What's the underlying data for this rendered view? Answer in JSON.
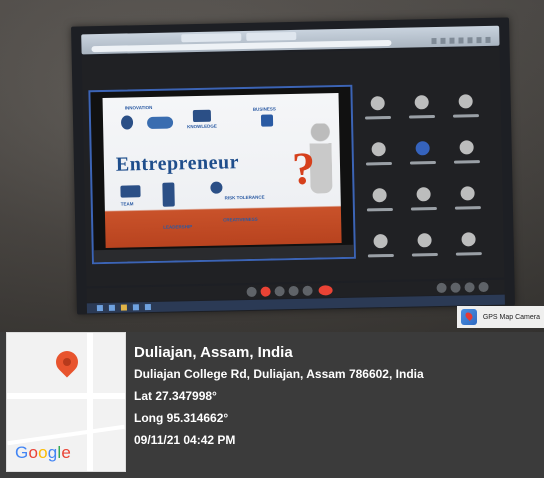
{
  "slide": {
    "title": "Entrepreneur",
    "words": [
      "INNOVATION",
      "BUSINESS",
      "KNOWLEDGE",
      "TEAM",
      "LEADERSHIP",
      "RISK TOLERANCE",
      "CREATIVENESS"
    ]
  },
  "gps_badge": "GPS Map Camera",
  "location": {
    "city": "Duliajan, Assam, India",
    "address": "Duliajan College Rd, Duliajan, Assam 786602, India",
    "lat": "Lat 27.347998°",
    "long": "Long 95.314662°",
    "timestamp": "09/11/21 04:42 PM"
  },
  "map": {
    "brand": "Google",
    "icon": "map-pin-icon",
    "pin_color": "#e8542e"
  }
}
